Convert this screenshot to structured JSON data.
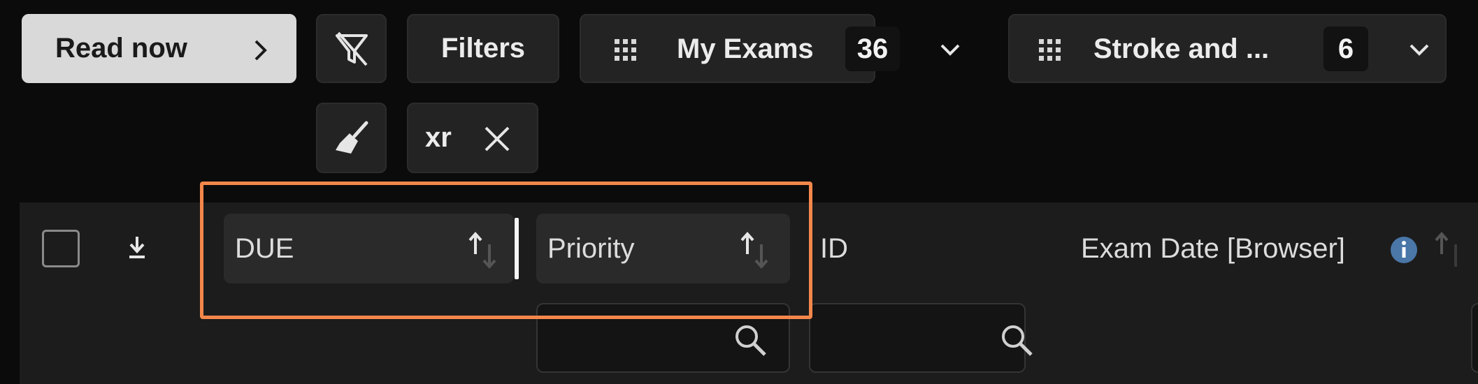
{
  "toolbar": {
    "read_now_label": "Read now",
    "filters_label": "Filters",
    "worklists": [
      {
        "label": "My Exams",
        "count": "36"
      },
      {
        "label": "Stroke and ...",
        "count": "6"
      }
    ],
    "active_filter_chip": "xr"
  },
  "table": {
    "columns": {
      "due": "DUE",
      "priority": "Priority",
      "id": "ID",
      "exam_date": "Exam Date [Browser]"
    }
  },
  "colors": {
    "background": "#0b0b0b",
    "header_band": "#1c1c1c",
    "button": "#232323",
    "highlight": "#f4874b",
    "info_icon": "#4a76a8"
  }
}
